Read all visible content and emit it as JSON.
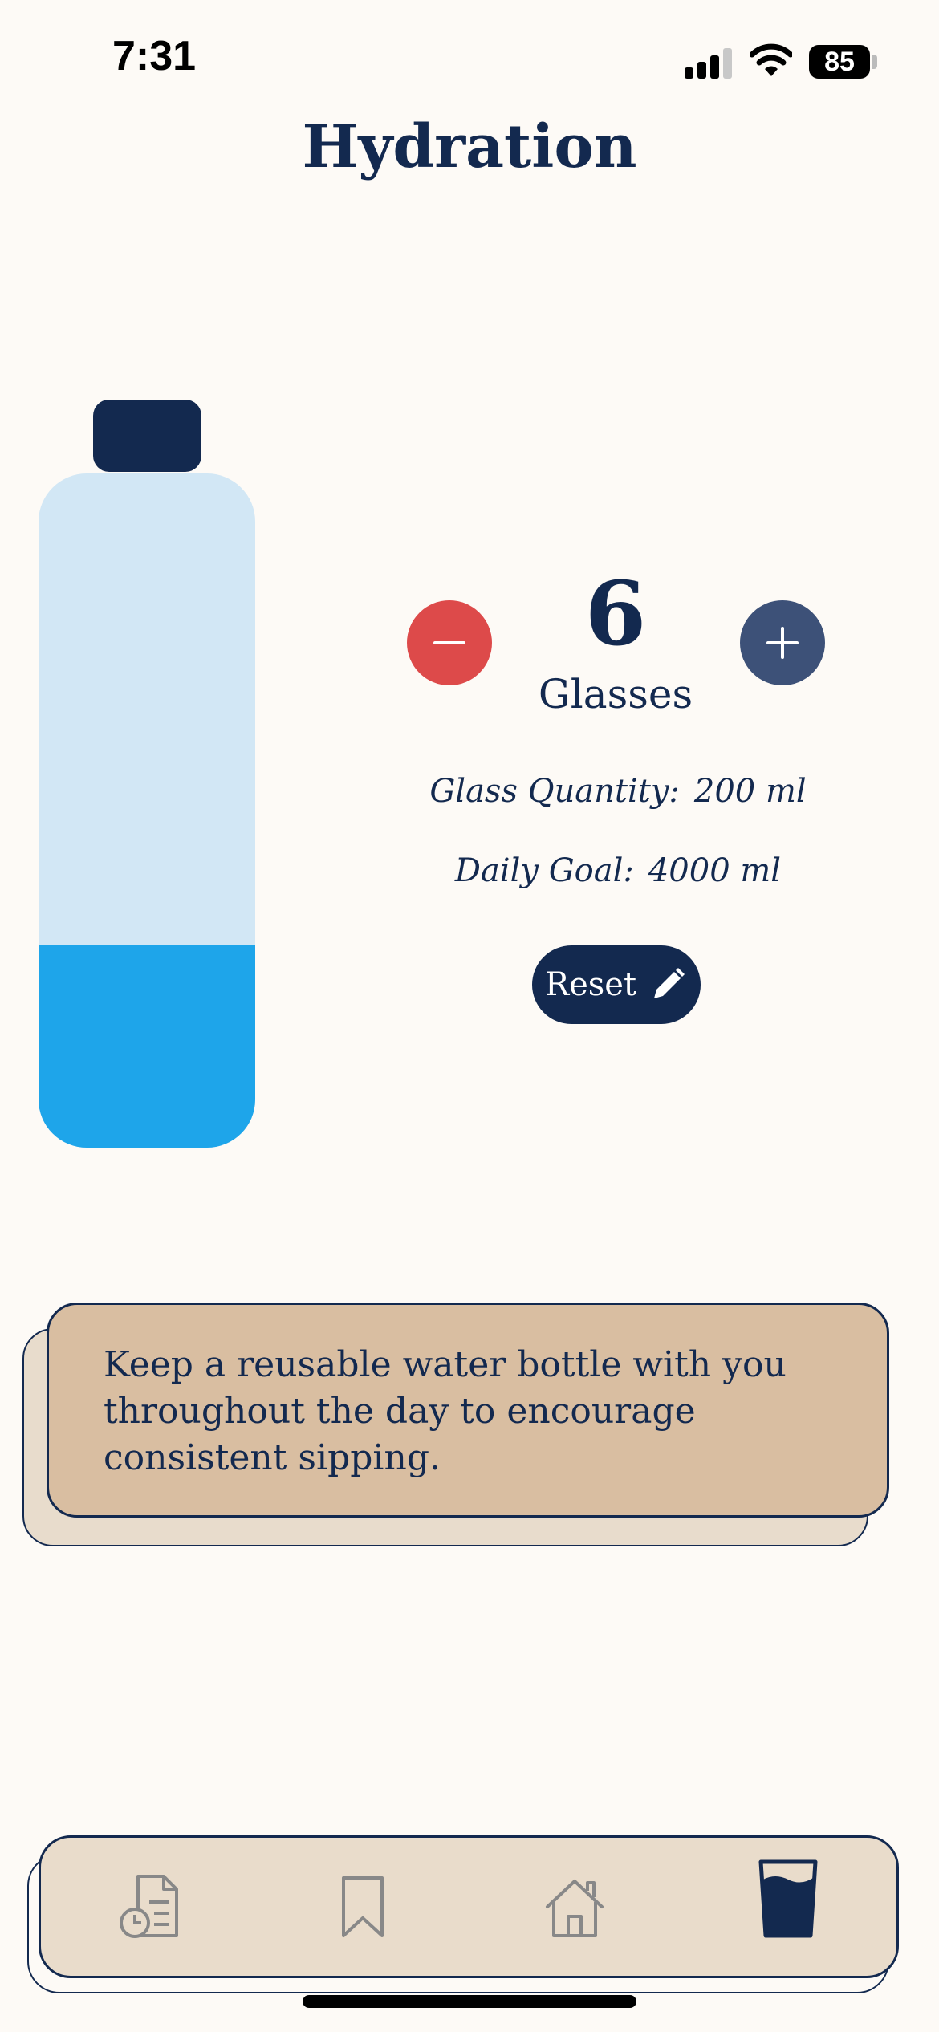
{
  "status_bar": {
    "time": "7:31",
    "battery": "85"
  },
  "header": {
    "title": "Hydration"
  },
  "bottle": {
    "fill_fraction": 0.3
  },
  "counter": {
    "count": "6",
    "unit_label": "Glasses",
    "decrement_icon": "minus-icon",
    "increment_icon": "plus-icon"
  },
  "info": {
    "glass_quantity_label": "Glass Quantity:",
    "glass_quantity_value": "200 ml",
    "daily_goal_label": "Daily Goal:",
    "daily_goal_value": "4000 ml"
  },
  "reset": {
    "label": "Reset",
    "icon": "pencil-icon"
  },
  "tip": {
    "text": "Keep a reusable water bottle with you throughout the day to encourage consistent sipping."
  },
  "tab_bar": {
    "tabs": [
      {
        "icon": "history-document-icon",
        "active": false
      },
      {
        "icon": "bookmark-icon",
        "active": false
      },
      {
        "icon": "home-icon",
        "active": false
      },
      {
        "icon": "water-glass-icon",
        "active": true
      }
    ]
  },
  "colors": {
    "background": "#fdfaf6",
    "navy": "#13294f",
    "minus_red": "#dd4a4a",
    "plus_slate": "#3d5178",
    "water_blue": "#1ea5ea",
    "bottle_light": "#d2e7f5",
    "card_tan": "#d9bea1",
    "tab_beige": "#e9dccb"
  }
}
